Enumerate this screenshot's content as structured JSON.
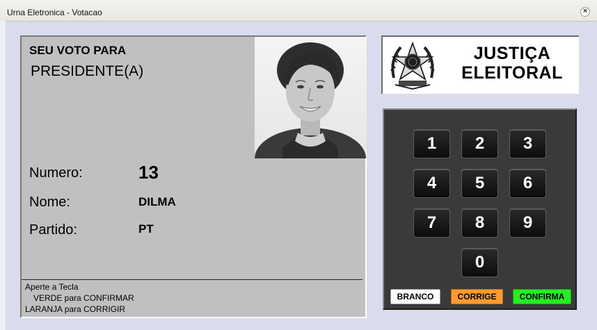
{
  "window": {
    "title": "Urna Eletronica - Votacao",
    "close_symbol": "×"
  },
  "ballot": {
    "header": "SEU VOTO PARA",
    "office": "PRESIDENTE(A)",
    "fields": [
      {
        "label": "Numero:",
        "value": "13"
      },
      {
        "label": "Nome:",
        "value": "DILMA"
      },
      {
        "label": "Partido:",
        "value": "PT"
      }
    ],
    "instructions": [
      "Aperte a Tecla",
      "VERDE para CONFIRMAR",
      "LARANJA para CORRIGIR"
    ]
  },
  "logo": {
    "line1": "JUSTIÇA",
    "line2": "ELEITORAL"
  },
  "keypad": {
    "keys": [
      "1",
      "2",
      "3",
      "4",
      "5",
      "6",
      "7",
      "8",
      "9",
      "0"
    ],
    "actions": [
      {
        "label": "BRANCO",
        "color": "#ffffff"
      },
      {
        "label": "CORRIGE",
        "color": "#ff9a2e"
      },
      {
        "label": "CONFIRMA",
        "color": "#22ee22"
      }
    ]
  },
  "colors": {
    "screen": "#c0c0c0",
    "keypad": "#3a3a3a",
    "background": "#d8dcec"
  }
}
